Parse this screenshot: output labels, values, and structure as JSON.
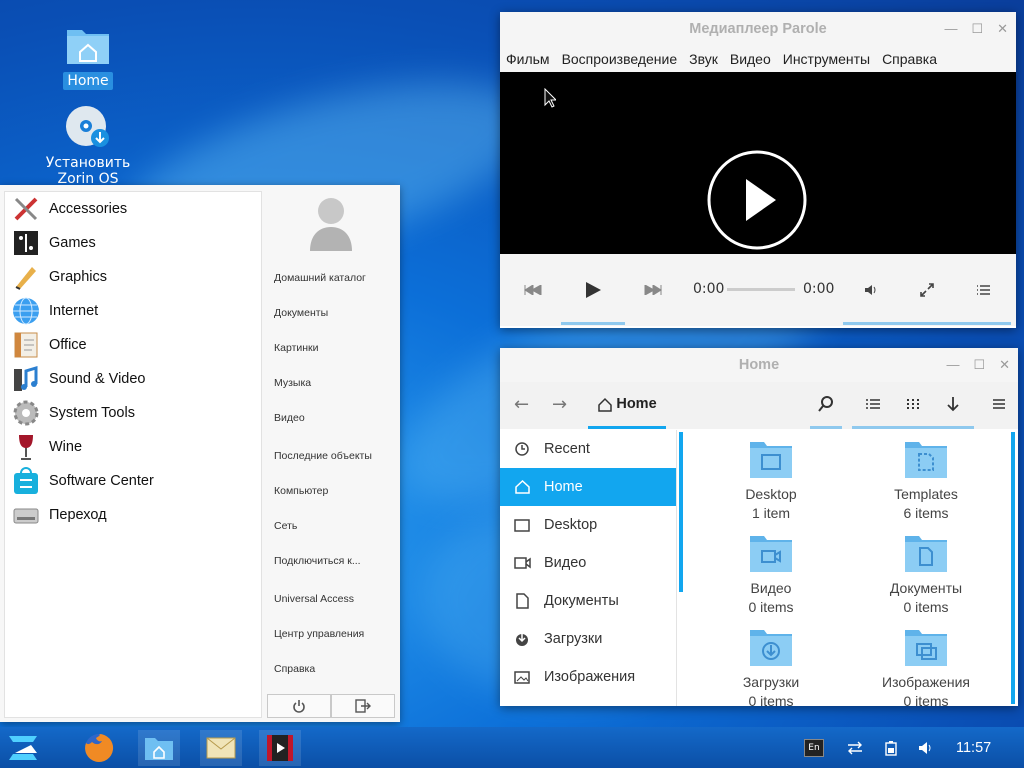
{
  "desktop": {
    "icons": [
      {
        "label": "Home",
        "icon": "home-folder-icon"
      },
      {
        "label": "Установить Zorin OS",
        "icon": "installer-disc-icon"
      }
    ]
  },
  "start_menu": {
    "categories": [
      {
        "label": "Accessories",
        "icon": "accessories-icon"
      },
      {
        "label": "Games",
        "icon": "games-icon"
      },
      {
        "label": "Graphics",
        "icon": "graphics-icon"
      },
      {
        "label": "Internet",
        "icon": "internet-globe-icon"
      },
      {
        "label": "Office",
        "icon": "office-icon"
      },
      {
        "label": "Sound & Video",
        "icon": "sound-video-icon"
      },
      {
        "label": "System Tools",
        "icon": "system-tools-gear-icon"
      },
      {
        "label": "Wine",
        "icon": "wine-glass-icon"
      },
      {
        "label": "Software Center",
        "icon": "software-center-icon"
      },
      {
        "label": "Переход",
        "icon": "drive-icon"
      }
    ],
    "places": [
      "Домашний каталог",
      "Документы",
      "Картинки",
      "Музыка",
      "Видео",
      "Последние объекты",
      "Компьютер",
      "Сеть",
      "Подключиться к...",
      "Universal Access",
      "Центр управления",
      "Справка"
    ]
  },
  "player": {
    "title": "Медиаплеер Parole",
    "menu": [
      "Фильм",
      "Воспроизведение",
      "Звук",
      "Видео",
      "Инструменты",
      "Справка"
    ],
    "time_current": "0:00",
    "time_total": "0:00"
  },
  "file_manager": {
    "title": "Home",
    "location": "Home",
    "sidebar": [
      {
        "label": "Recent",
        "icon": "clock-icon",
        "active": false
      },
      {
        "label": "Home",
        "icon": "home-icon",
        "active": true
      },
      {
        "label": "Desktop",
        "icon": "desktop-icon",
        "active": false
      },
      {
        "label": "Видео",
        "icon": "video-camera-icon",
        "active": false
      },
      {
        "label": "Документы",
        "icon": "document-icon",
        "active": false
      },
      {
        "label": "Загрузки",
        "icon": "download-icon",
        "active": false
      },
      {
        "label": "Изображения",
        "icon": "image-icon",
        "active": false
      }
    ],
    "folders": [
      {
        "name": "Desktop",
        "count": "1 item",
        "icon": "desktop-folder-icon"
      },
      {
        "name": "Templates",
        "count": "6 items",
        "icon": "templates-folder-icon"
      },
      {
        "name": "Видео",
        "count": "0 items",
        "icon": "video-folder-icon"
      },
      {
        "name": "Документы",
        "count": "0 items",
        "icon": "documents-folder-icon"
      },
      {
        "name": "Загрузки",
        "count": "0 items",
        "icon": "downloads-folder-icon"
      },
      {
        "name": "Изображения",
        "count": "0 items",
        "icon": "pictures-folder-icon"
      }
    ]
  },
  "taskbar": {
    "keyboard_layout": "En",
    "clock": "11:57"
  },
  "colors": {
    "accent": "#12a6ef",
    "folder": "#7cc3ef",
    "taskbar": "#0b58b5"
  }
}
